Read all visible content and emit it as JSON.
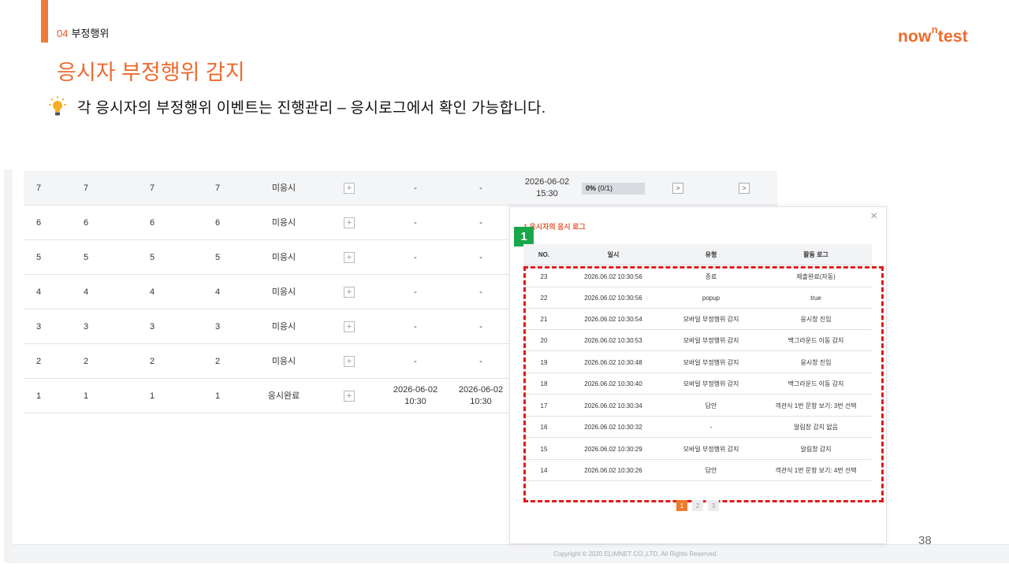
{
  "slide": {
    "section_number": "04",
    "section_name": "부정행위",
    "logo_text_a": "now",
    "logo_text_sup": "n",
    "logo_text_b": "test",
    "title": "응시자 부정행위 감지",
    "bullet": "각 응시자의 부정행위 이벤트는 진행관리 – 응시로그에서 확인 가능합니다.",
    "page_number": "38"
  },
  "background_table": {
    "rows": [
      {
        "c1": "7",
        "c2": "7",
        "c3": "7",
        "c4": "7",
        "status": "미응시",
        "start": "-",
        "end": "-",
        "date_line1": "2026-06-02",
        "date_line2": "15:30",
        "progress_pct": "0%",
        "progress_count": "(0/1)"
      },
      {
        "c1": "6",
        "c2": "6",
        "c3": "6",
        "c4": "6",
        "status": "미응시",
        "start": "-",
        "end": "-"
      },
      {
        "c1": "5",
        "c2": "5",
        "c3": "5",
        "c4": "5",
        "status": "미응시",
        "start": "-",
        "end": "-"
      },
      {
        "c1": "4",
        "c2": "4",
        "c3": "4",
        "c4": "4",
        "status": "미응시",
        "start": "-",
        "end": "-"
      },
      {
        "c1": "3",
        "c2": "3",
        "c3": "3",
        "c4": "3",
        "status": "미응시",
        "start": "-",
        "end": "-"
      },
      {
        "c1": "2",
        "c2": "2",
        "c3": "2",
        "c4": "2",
        "status": "미응시",
        "start": "-",
        "end": "-"
      },
      {
        "c1": "1",
        "c2": "1",
        "c3": "1",
        "c4": "1",
        "status": "응시완료",
        "start_line1": "2026-06-02",
        "start_line2": "10:30",
        "end_line1": "2026-06-02",
        "end_line2": "10:30"
      }
    ],
    "plus_glyph": "+",
    "arrow_glyph": ">"
  },
  "modal": {
    "title": "1 응시자의 응시 로그",
    "badge": "1",
    "close_glyph": "×",
    "columns": {
      "no": "NO.",
      "datetime": "일시",
      "type": "유형",
      "log": "활동 로그"
    },
    "rows": [
      {
        "no": "23",
        "datetime": "2026.06.02 10:30:56",
        "type": "종료",
        "log": "제출완료(자동)"
      },
      {
        "no": "22",
        "datetime": "2026.06.02 10:30:56",
        "type": "popup",
        "log": "true"
      },
      {
        "no": "21",
        "datetime": "2026.06.02 10:30:54",
        "type": "모바일 부정행위 감지",
        "log": "응시창 진입"
      },
      {
        "no": "20",
        "datetime": "2026.06.02 10:30:53",
        "type": "모바일 부정행위 감지",
        "log": "백그라운드 이동 감지"
      },
      {
        "no": "19",
        "datetime": "2026.06.02 10:30:48",
        "type": "모바일 부정행위 감지",
        "log": "응시창 진입"
      },
      {
        "no": "18",
        "datetime": "2026.06.02 10:30:40",
        "type": "모바일 부정행위 감지",
        "log": "백그라운드 이동 감지"
      },
      {
        "no": "17",
        "datetime": "2026.06.02 10:30:34",
        "type": "답안",
        "log": "객관식 1번 문항 보기: 3번 선택"
      },
      {
        "no": "16",
        "datetime": "2026.06.02 10:30:32",
        "type": "-",
        "log": "알림창 감지 없음"
      },
      {
        "no": "15",
        "datetime": "2026.06.02 10:30:29",
        "type": "모바일 부정행위 감지",
        "log": "알림창 감지"
      },
      {
        "no": "14",
        "datetime": "2026.06.02 10:30:26",
        "type": "답안",
        "log": "객관식 1번 문항 보기: 4번 선택"
      }
    ],
    "pagination": [
      "1",
      "2",
      "3"
    ],
    "active_page": "1"
  },
  "footer": {
    "copyright": "Copyright © 2020 ELIMNET CO.,LTD. All Rights Reserved."
  },
  "colors": {
    "accent": "#ee7b3a",
    "title": "#ee6a2f",
    "highlight_box": "#e01b1b",
    "badge": "#1aa64b"
  }
}
